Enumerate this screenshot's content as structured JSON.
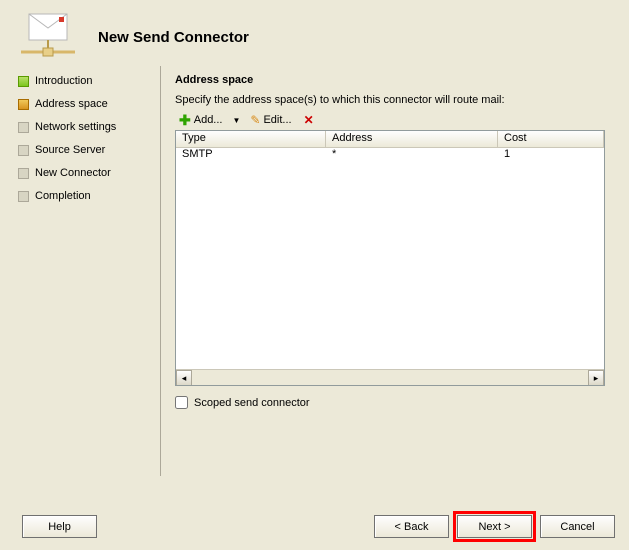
{
  "title": "New Send Connector",
  "sidebar": {
    "steps": [
      {
        "label": "Introduction",
        "state": "done"
      },
      {
        "label": "Address space",
        "state": "active"
      },
      {
        "label": "Network settings",
        "state": "pending"
      },
      {
        "label": "Source Server",
        "state": "pending"
      },
      {
        "label": "New Connector",
        "state": "pending"
      },
      {
        "label": "Completion",
        "state": "pending"
      }
    ]
  },
  "main": {
    "section_title": "Address space",
    "instruction": "Specify the address space(s) to which this connector will route mail:",
    "toolbar": {
      "add_label": "Add...",
      "edit_label": "Edit..."
    },
    "table": {
      "headers": {
        "type": "Type",
        "address": "Address",
        "cost": "Cost"
      },
      "rows": [
        {
          "type": "SMTP",
          "address": "*",
          "cost": "1"
        }
      ]
    },
    "scoped_label": "Scoped send connector",
    "scoped_checked": false
  },
  "buttons": {
    "help": "Help",
    "back": "< Back",
    "next": "Next >",
    "cancel": "Cancel"
  }
}
